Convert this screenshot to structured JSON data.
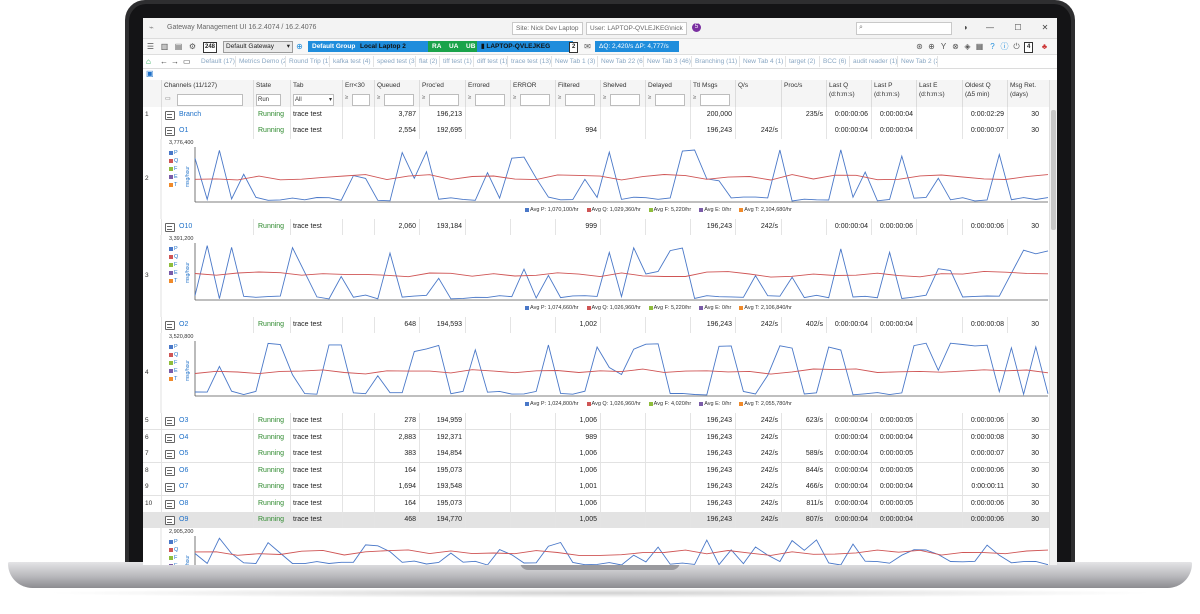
{
  "titlebar": {
    "title": "Gateway Management UI 16.2.4074 / 16.2.4076",
    "site": "Site: Nick Dev Laptop",
    "user": "User: LAPTOP-QVLEJKEG\\nick",
    "badge": "5",
    "minimize": "—",
    "maximize": "☐",
    "close": "✕"
  },
  "toolbar": {
    "counter": "248",
    "gateway": "Default Gateway",
    "group": "Default Group",
    "local": "Local Laptop 2",
    "ra": "RA",
    "ua": "UA",
    "ub": "UB",
    "laptop": "LAPTOP-QVLEJKEG",
    "laptop_count": "2",
    "stats": "ΔQ: 2,420/s  ΔP: 4,777/s",
    "right_box": "4"
  },
  "tabs": [
    "Default (17)",
    "Metrics Demo (2)",
    "Round Trip (1)",
    "kafka test (4)",
    "speed test (3)",
    "flat (2)",
    "tiff test (1)",
    "diff test (1)",
    "trace test (13)",
    "New Tab 1 (3)",
    "New Tab 22 (6)",
    "New Tab 3 (46)",
    "Branching (11)",
    "New Tab 4 (1)",
    "target (2)",
    "BCC (6)",
    "audit reader (1)",
    "New Tab 2 (2)"
  ],
  "columns": {
    "channels": "Channels (11/127)",
    "state": "State",
    "state_filter": "Run",
    "tab": "Tab",
    "tab_filter": "All",
    "err": "Err<30",
    "queued": "Queued",
    "procd": "Proc'ed",
    "errored": "Errored",
    "error_e": "ERROR",
    "filtered": "Filtered",
    "shelved": "Shelved",
    "delayed": "Delayed",
    "ttl": "Ttl Msgs",
    "qs": "Q/s",
    "procs": "Proc/s",
    "lastq": "Last Q",
    "lastq2": "(d:h:m:s)",
    "lastp": "Last P",
    "lastp2": "(d:h:m:s)",
    "laste": "Last E",
    "laste2": "(d:h:m:s)",
    "oldest": "Oldest Q",
    "oldest2": "(Δ5 min)",
    "msgret": "Msg Ret.",
    "msgret2": "(days)",
    "ge": "≥"
  },
  "rows": [
    {
      "num": "1",
      "name": "Branch",
      "state": "Running",
      "tab": "trace test",
      "queued": "3,787",
      "procd": "196,213",
      "filtered": "",
      "ttl": "200,000",
      "qs": "",
      "procs": "235/s",
      "lastq": "0:00:00:06",
      "lastp": "0:00:00:04",
      "laste": "",
      "oldest": "0:00:02:29",
      "ret": "30"
    },
    {
      "num": "",
      "name": "O1",
      "state": "Running",
      "tab": "trace test",
      "queued": "2,554",
      "procd": "192,695",
      "filtered": "994",
      "ttl": "196,243",
      "qs": "242/s",
      "procs": "",
      "lastq": "0:00:00:04",
      "lastp": "0:00:00:04",
      "laste": "",
      "oldest": "0:00:00:07",
      "ret": "30"
    },
    {
      "num": "",
      "name": "O10",
      "state": "Running",
      "tab": "trace test",
      "queued": "2,060",
      "procd": "193,184",
      "filtered": "999",
      "ttl": "196,243",
      "qs": "242/s",
      "procs": "",
      "lastq": "0:00:00:04",
      "lastp": "0:00:00:06",
      "laste": "",
      "oldest": "0:00:00:06",
      "ret": "30"
    },
    {
      "num": "",
      "name": "O2",
      "state": "Running",
      "tab": "trace test",
      "queued": "648",
      "procd": "194,593",
      "filtered": "1,002",
      "ttl": "196,243",
      "qs": "242/s",
      "procs": "402/s",
      "lastq": "0:00:00:04",
      "lastp": "0:00:00:04",
      "laste": "",
      "oldest": "0:00:00:08",
      "ret": "30"
    },
    {
      "num": "5",
      "name": "O3",
      "state": "Running",
      "tab": "trace test",
      "queued": "278",
      "procd": "194,959",
      "filtered": "1,006",
      "ttl": "196,243",
      "qs": "242/s",
      "procs": "623/s",
      "lastq": "0:00:00:04",
      "lastp": "0:00:00:05",
      "laste": "",
      "oldest": "0:00:00:06",
      "ret": "30"
    },
    {
      "num": "6",
      "name": "O4",
      "state": "Running",
      "tab": "trace test",
      "queued": "2,883",
      "procd": "192,371",
      "filtered": "989",
      "ttl": "196,243",
      "qs": "242/s",
      "procs": "",
      "lastq": "0:00:00:04",
      "lastp": "0:00:00:04",
      "laste": "",
      "oldest": "0:00:00:08",
      "ret": "30"
    },
    {
      "num": "7",
      "name": "O5",
      "state": "Running",
      "tab": "trace test",
      "queued": "383",
      "procd": "194,854",
      "filtered": "1,006",
      "ttl": "196,243",
      "qs": "242/s",
      "procs": "589/s",
      "lastq": "0:00:00:04",
      "lastp": "0:00:00:05",
      "laste": "",
      "oldest": "0:00:00:07",
      "ret": "30"
    },
    {
      "num": "8",
      "name": "O6",
      "state": "Running",
      "tab": "trace test",
      "queued": "164",
      "procd": "195,073",
      "filtered": "1,006",
      "ttl": "196,243",
      "qs": "242/s",
      "procs": "844/s",
      "lastq": "0:00:00:04",
      "lastp": "0:00:00:05",
      "laste": "",
      "oldest": "0:00:00:06",
      "ret": "30"
    },
    {
      "num": "9",
      "name": "O7",
      "state": "Running",
      "tab": "trace test",
      "queued": "1,694",
      "procd": "193,548",
      "filtered": "1,001",
      "ttl": "196,243",
      "qs": "242/s",
      "procs": "466/s",
      "lastq": "0:00:00:04",
      "lastp": "0:00:00:04",
      "laste": "",
      "oldest": "0:00:00:11",
      "ret": "30"
    },
    {
      "num": "10",
      "name": "O8",
      "state": "Running",
      "tab": "trace test",
      "queued": "164",
      "procd": "195,073",
      "filtered": "1,006",
      "ttl": "196,243",
      "qs": "242/s",
      "procs": "811/s",
      "lastq": "0:00:00:04",
      "lastp": "0:00:00:05",
      "laste": "",
      "oldest": "0:00:00:06",
      "ret": "30"
    },
    {
      "num": "",
      "name": "O9",
      "state": "Running",
      "tab": "trace test",
      "queued": "468",
      "procd": "194,770",
      "filtered": "1,005",
      "ttl": "196,243",
      "qs": "242/s",
      "procs": "807/s",
      "lastq": "0:00:00:04",
      "lastp": "0:00:00:04",
      "laste": "",
      "oldest": "0:00:00:06",
      "ret": "30"
    }
  ],
  "charts": [
    {
      "num": "2",
      "ymax": "3,776,400",
      "ylabel": "msg/hour",
      "legend": [
        "Avg P: 1,070,100/hr",
        "Avg Q: 1,029,360/hr",
        "Avg F: 5,220/hr",
        "Avg E: 0/hr",
        "Avg T: 2,104,680/hr"
      ]
    },
    {
      "num": "3",
      "ymax": "3,391,200",
      "ylabel": "msg/hour",
      "legend": [
        "Avg P: 1,074,660/hr",
        "Avg Q: 1,026,960/hr",
        "Avg F: 5,220/hr",
        "Avg E: 0/hr",
        "Avg T: 2,106,840/hr"
      ]
    },
    {
      "num": "4",
      "ymax": "3,520,800",
      "ylabel": "msg/hour",
      "legend": [
        "Avg P: 1,024,800/hr",
        "Avg Q: 1,026,960/hr",
        "Avg F: 4,020/hr",
        "Avg E: 0/hr",
        "Avg T: 2,055,780/hr"
      ]
    },
    {
      "num": "",
      "ymax": "2,905,200",
      "ylabel": "msg/hour",
      "legend": []
    }
  ],
  "side_legend": [
    "P",
    "Q",
    "F",
    "E",
    "T"
  ],
  "colors": {
    "p": "#4a78c8",
    "q": "#cf5555",
    "f": "#8fbd3c",
    "e": "#7a5ca8",
    "t": "#f08a2a",
    "running": "#2d8a2d",
    "link": "#1e70c8"
  }
}
